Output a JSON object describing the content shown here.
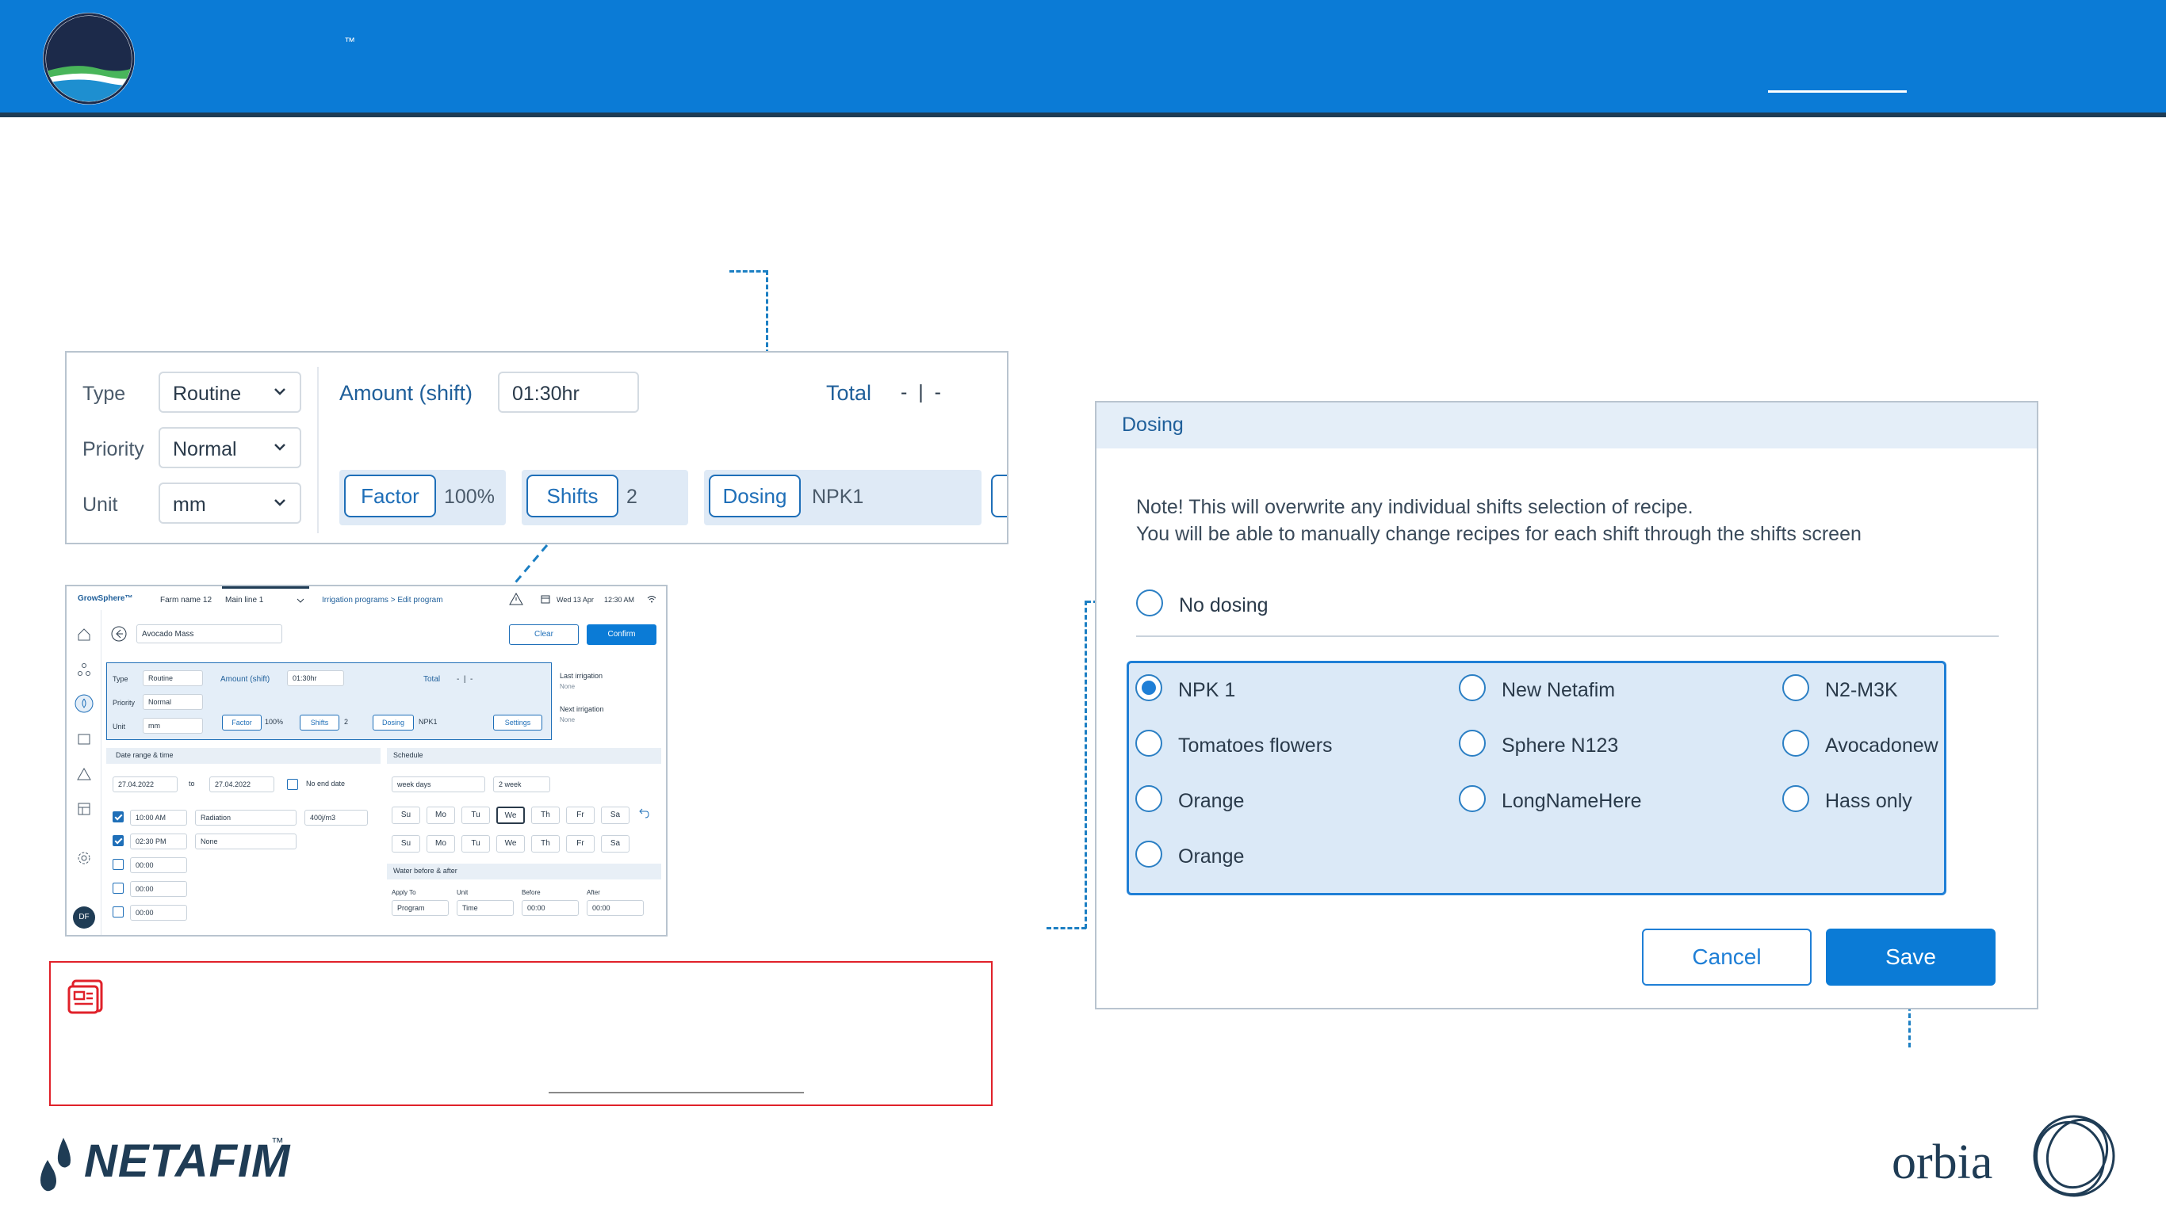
{
  "header": {
    "tm": "™"
  },
  "program_card": {
    "type_label": "Type",
    "type_value": "Routine",
    "priority_label": "Priority",
    "priority_value": "Normal",
    "unit_label": "Unit",
    "unit_value": "mm",
    "amount_label": "Amount (shift)",
    "amount_value": "01:30hr",
    "total_label": "Total",
    "total_value": "-  |  -",
    "factor_label": "Factor",
    "factor_value": "100%",
    "shifts_label": "Shifts",
    "shifts_value": "2",
    "dosing_label": "Dosing",
    "dosing_value": "NPK1"
  },
  "mini": {
    "brand": "GrowSphere™",
    "farm": "Farm name 12",
    "line": "Main line 1",
    "breadcrumb": "Irrigation programs  >  Edit program",
    "date": "Wed 13 Apr",
    "time": "12:30 AM",
    "program_name": "Avocado Mass",
    "clear": "Clear",
    "confirm": "Confirm",
    "type_label": "Type",
    "type_value": "Routine",
    "priority_label": "Priority",
    "priority_value": "Normal",
    "unit_label": "Unit",
    "unit_value": "mm",
    "amount_label": "Amount (shift)",
    "amount_value": "01:30hr",
    "total_label": "Total",
    "total_value": "-  |  -",
    "factor": "Factor",
    "factor_value": "100%",
    "shifts": "Shifts",
    "shifts_value": "2",
    "dosing": "Dosing",
    "dosing_value": "NPK1",
    "settings": "Settings",
    "last_irrigation": "Last irrigation",
    "last_irrigation_value": "None",
    "next_irrigation": "Next irrigation",
    "next_irrigation_value": "None",
    "date_section": "Date range & time",
    "date_from": "27.04.2022",
    "to": "to",
    "date_to": "27.04.2022",
    "no_end": "No end date",
    "times": [
      "10:00 AM",
      "02:30 PM",
      "00:00",
      "00:00",
      "00:00"
    ],
    "radiation": "Radiation",
    "radiation_value": "400j/m3",
    "none": "None",
    "schedule": "Schedule",
    "week_days": "week days",
    "two_week": "2 week",
    "days": [
      "Su",
      "Mo",
      "Tu",
      "We",
      "Th",
      "Fr",
      "Sa"
    ],
    "water_section": "Water before & after",
    "apply_to": "Apply To",
    "apply_value": "Program",
    "unit2": "Unit",
    "unit2_value": "Time",
    "before": "Before",
    "before_value": "00:00",
    "after": "After",
    "after_value": "00:00",
    "avatar": "DF"
  },
  "dialog": {
    "title": "Dosing",
    "note_line1": "Note! This will overwrite any individual shifts selection of recipe.",
    "note_line2": "You will be able to manually change recipes for each shift through the shifts screen",
    "no_dosing": "No dosing",
    "recipes": [
      "NPK 1",
      "New Netafim",
      "N2-M3K",
      "Tomatoes flowers",
      "Sphere N123",
      "Avocadonew",
      "Orange",
      "LongNameHere",
      "Hass only",
      "Orange"
    ],
    "selected": "NPK 1",
    "cancel": "Cancel",
    "save": "Save"
  },
  "footer": {
    "netafim": "NETAFIM",
    "netafim_tm": "™",
    "orbia": "orbia"
  },
  "colors": {
    "brand_blue": "#0b7bd6",
    "note_red": "#e0212a",
    "panel_blue": "#dbe9f7"
  }
}
